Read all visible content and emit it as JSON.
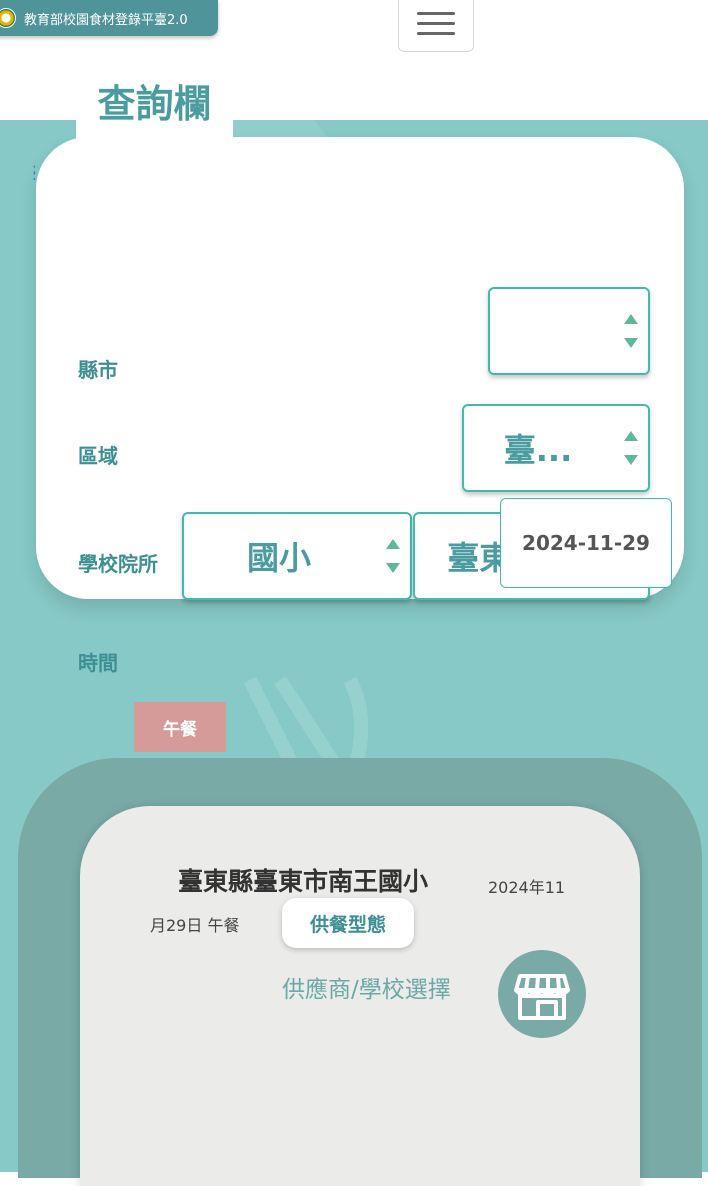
{
  "header": {
    "brand_title": "教育部校園食材登錄平臺2.0",
    "menu_icon": "hamburger-menu-icon"
  },
  "query": {
    "tab_title": "查詢欄",
    "fields": {
      "county": {
        "label": "縣市",
        "value": ""
      },
      "district": {
        "label": "區域",
        "value": "臺..."
      },
      "school": {
        "label": "學校院所",
        "level_value": "國小",
        "name_value": "臺東縣..."
      },
      "time": {
        "label": "時間",
        "value": "2024-11-29"
      }
    }
  },
  "meal": {
    "tab_label": "午餐",
    "school_name": "臺東縣臺東市南王國小",
    "date_line1": "2024年11",
    "date_line2": "月29日 午餐",
    "supply_type_button": "供餐型態",
    "supplier_label": "供應商/學校選擇",
    "supplier_icon": "store-icon"
  },
  "colors": {
    "brand": "#4f9499",
    "teal_bg": "#86c9c6",
    "accent": "#3ebdae",
    "label_text": "#3e8f93",
    "meal_tab": "#d59b99"
  }
}
